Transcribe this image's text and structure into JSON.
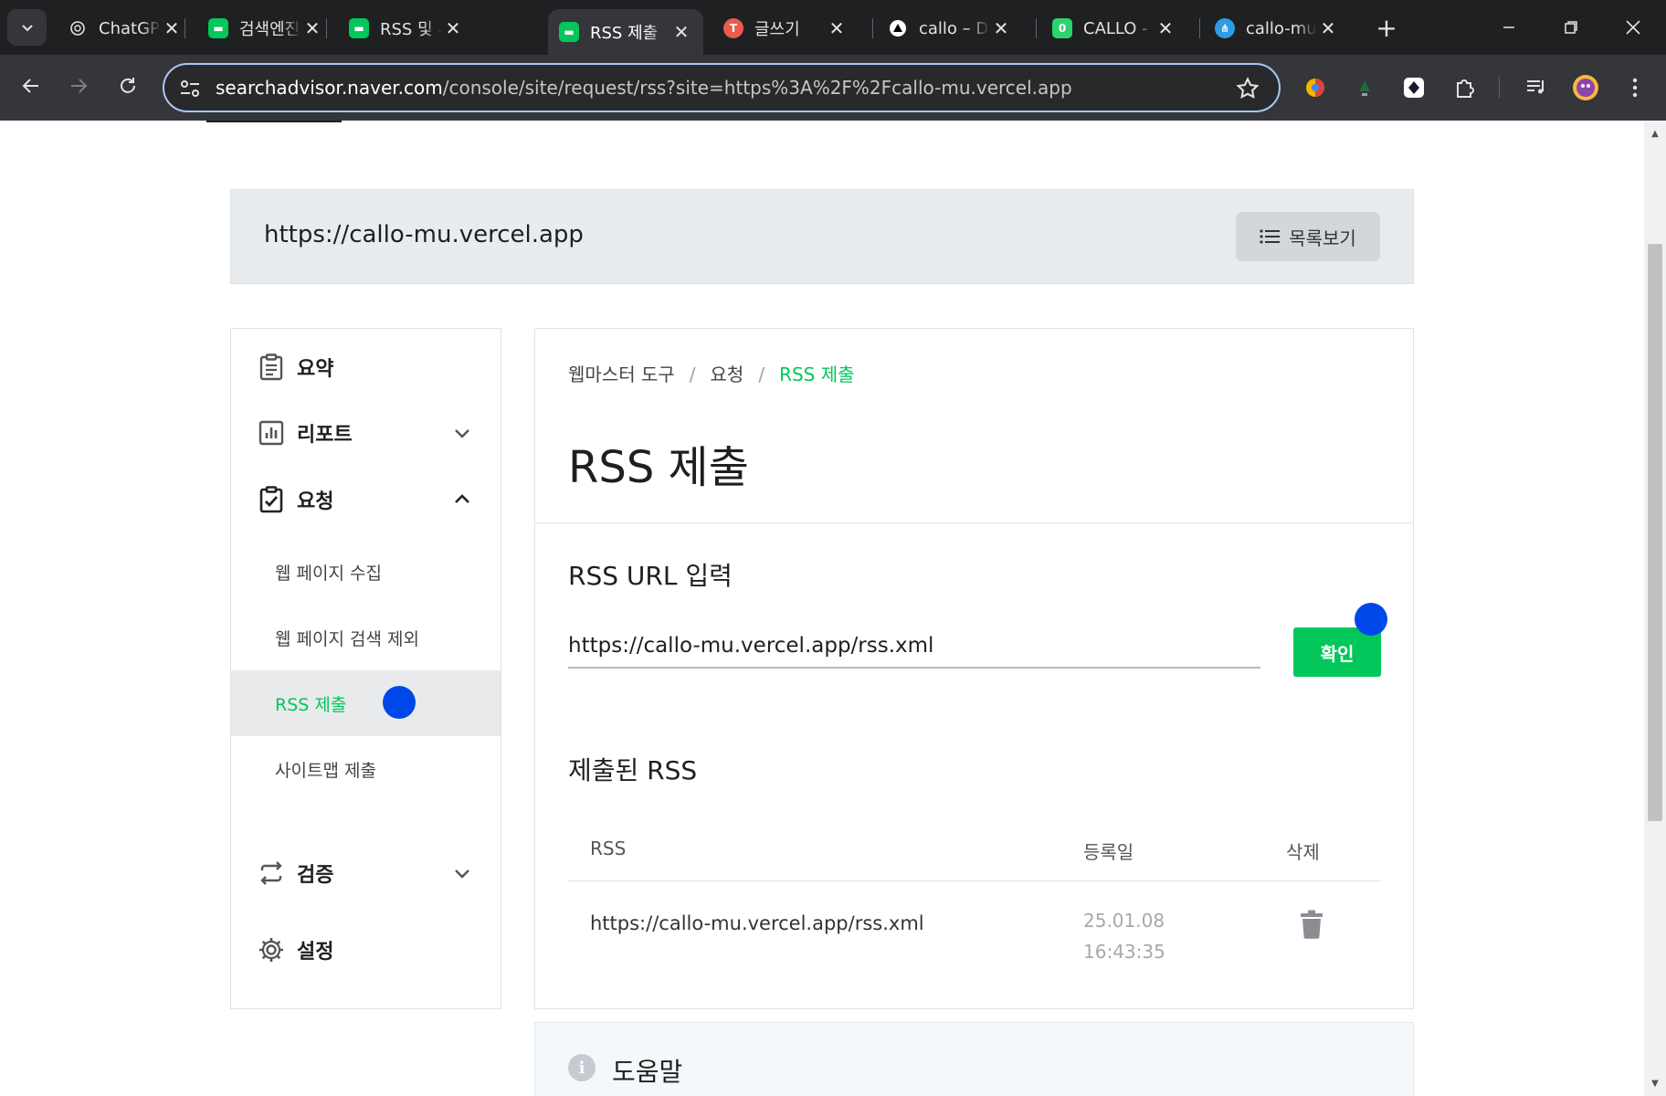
{
  "browser": {
    "tabs": [
      {
        "title": "ChatGPT",
        "favicon": "chatgpt-icon",
        "color": "#1f2021"
      },
      {
        "title": "검색엔진",
        "favicon": "naver-searchadvisor-icon",
        "color": "#03c75a"
      },
      {
        "title": "RSS 및 사",
        "favicon": "naver-searchadvisor-icon",
        "color": "#03c75a"
      },
      {
        "title": "RSS 제출",
        "favicon": "naver-searchadvisor-icon",
        "color": "#03c75a",
        "active": true
      },
      {
        "title": "글쓰기",
        "favicon": "tistory-icon",
        "color": "#eb5a4b"
      },
      {
        "title": "callo – D",
        "favicon": "vercel-icon",
        "color": "#ffffff"
      },
      {
        "title": "CALLO -",
        "favicon": "callo-icon",
        "color": "#2dd36f"
      },
      {
        "title": "callo-mu",
        "favicon": "sitemap-icon",
        "color": "#2f9de4"
      }
    ],
    "url_host": "searchadvisor.naver.com",
    "url_path": "/console/site/request/rss?site=https%3A%2F%2Fcallo-mu.vercel.app"
  },
  "site": {
    "url": "https://callo-mu.vercel.app",
    "list_button": "목록보기"
  },
  "sidebar": {
    "summary": "요약",
    "report": "리포트",
    "request": "요청",
    "sub_items": [
      "웹 페이지 수집",
      "웹 페이지 검색 제외",
      "RSS 제출",
      "사이트맵 제출"
    ],
    "verify": "검증",
    "settings": "설정"
  },
  "main": {
    "breadcrumb": [
      "웹마스터 도구",
      "요청",
      "RSS 제출"
    ],
    "breadcrumb_sep": "/",
    "title": "RSS 제출",
    "input_section_title": "RSS URL 입력",
    "input_value": "https://callo-mu.vercel.app/rss.xml",
    "confirm_button": "확인",
    "submitted_title": "제출된 RSS",
    "table_headers": [
      "RSS",
      "등록일",
      "삭제"
    ],
    "rows": [
      {
        "rss": "https://callo-mu.vercel.app/rss.xml",
        "date": "25.01.08 16:43:35"
      }
    ]
  },
  "help": {
    "title": "도움말",
    "icon": "info-icon"
  },
  "colors": {
    "brand_green": "#03c75a",
    "cursor_blue": "#0047ea"
  }
}
